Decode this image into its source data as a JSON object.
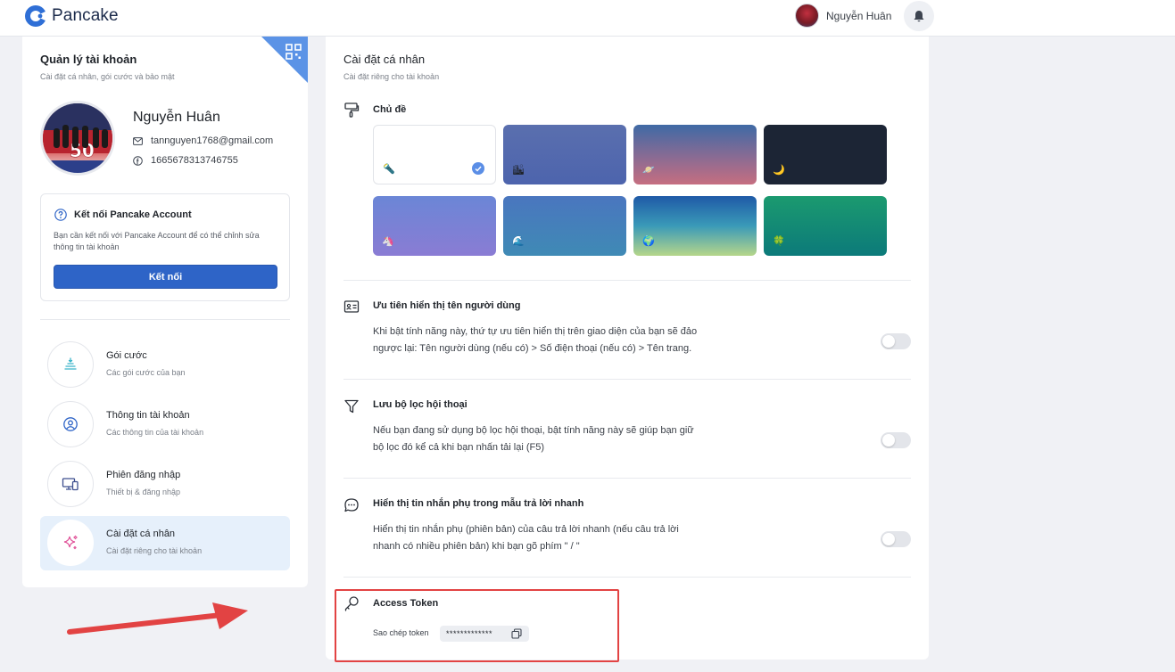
{
  "header": {
    "brand": "Pancake",
    "user_name": "Nguyễn Huân"
  },
  "left": {
    "title": "Quản lý tài khoản",
    "subtitle": "Cài đặt cá nhân, gói cước và bảo mật",
    "profile": {
      "name": "Nguyễn Huân",
      "email": "tannguyen1768@gmail.com",
      "id": "1665678313746755"
    },
    "connect": {
      "title": "Kết nối Pancake Account",
      "description": "Bạn cần kết nối với Pancake Account để có thể chỉnh sửa thông tin tài khoản",
      "button": "Kết nối"
    },
    "menu": [
      {
        "label": "Gói cước",
        "desc": "Các gói cước của bạn"
      },
      {
        "label": "Thông tin tài khoản",
        "desc": "Các thông tin của tài khoản"
      },
      {
        "label": "Phiên đăng nhập",
        "desc": "Thiết bị & đăng nhập"
      },
      {
        "label": "Cài đặt cá nhân",
        "desc": "Cài đặt riêng cho tài khoản"
      }
    ]
  },
  "main": {
    "title": "Cài đặt cá nhân",
    "subtitle": "Cài đặt riêng cho tài khoản",
    "theme": {
      "title": "Chủ đề",
      "tiles": [
        {
          "emoji": "🔦",
          "selected": true
        },
        {
          "emoji": "🏙",
          "selected": false
        },
        {
          "emoji": "🪐",
          "selected": false
        },
        {
          "emoji": "🌙",
          "selected": false
        },
        {
          "emoji": "🦄",
          "selected": false
        },
        {
          "emoji": "🌊",
          "selected": false
        },
        {
          "emoji": "🌍",
          "selected": false
        },
        {
          "emoji": "🍀",
          "selected": false
        }
      ]
    },
    "username_priority": {
      "title": "Ưu tiên hiển thị tên người dùng",
      "desc_line1": "Khi bật tính năng này, thứ tự ưu tiên hiển thị trên giao diện của bạn sẽ đảo",
      "desc_line2": "ngược lại: Tên người dùng (nếu có) > Số điện thoại (nếu có) > Tên trang.",
      "enabled": false
    },
    "save_filter": {
      "title": "Lưu bộ lọc hội thoại",
      "desc_line1": "Nếu bạn đang sử dụng bộ lọc hội thoại, bật tính năng này sẽ giúp bạn giữ",
      "desc_line2": "bộ lọc đó kể cả khi bạn nhấn tải lại (F5)",
      "enabled": false
    },
    "sub_message": {
      "title": "Hiển thị tin nhắn phụ trong mẫu trả lời nhanh",
      "desc_line1": "Hiển thị tin nhắn phụ (phiên bản) của câu trả lời nhanh (nếu câu trả lời",
      "desc_line2": "nhanh có nhiều phiên bản) khi bạn gõ phím \" / \"",
      "enabled": false
    },
    "access_token": {
      "title": "Access Token",
      "copy_label": "Sao chép token",
      "masked": "*************"
    }
  },
  "colors": {
    "accent": "#2e64c7",
    "highlight": "#e24343"
  }
}
